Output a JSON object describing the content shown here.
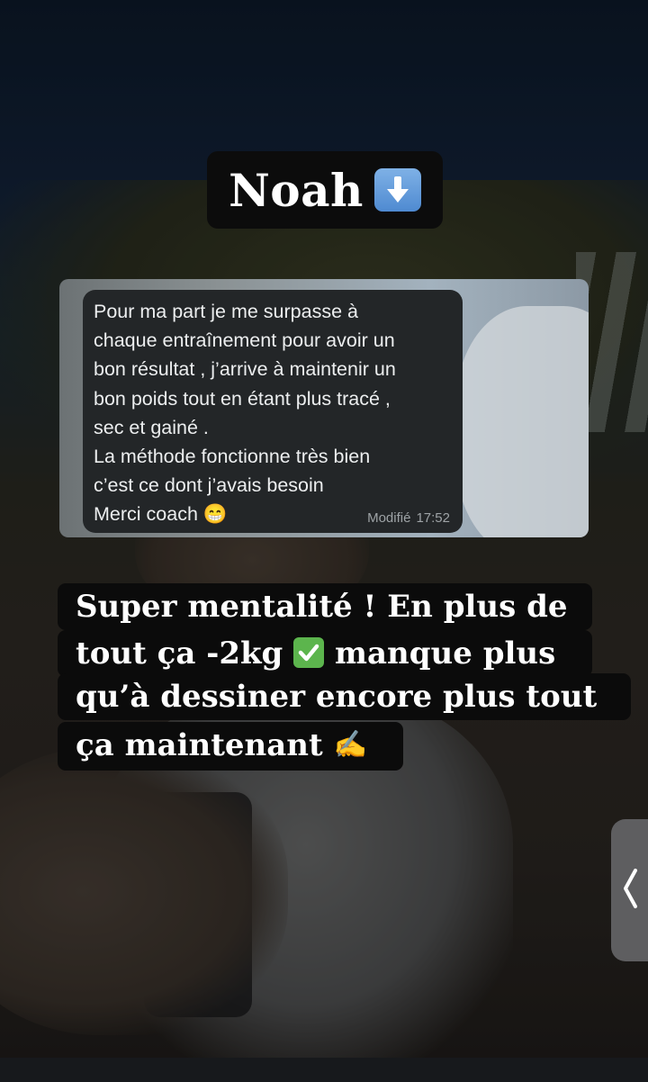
{
  "story": {
    "name_tag": {
      "name": "Noah",
      "icon": "down-arrow-icon"
    },
    "screenshot": {
      "message_lines": [
        "Pour ma part je me surpasse à",
        "chaque entraînement pour avoir un",
        "bon résultat , j’arrive à maintenir un",
        "bon poids tout en étant plus tracé ,",
        "sec et gainé .",
        "La méthode fonctionne très bien",
        "c’est ce dont j’avais besoin",
        "Merci coach 😁"
      ],
      "edited_label": "Modifié",
      "time": "17:52"
    },
    "caption": {
      "line1": "Super mentalité ! En plus de",
      "line2_before": "tout ça -2kg",
      "line2_after": "manque plus",
      "line3": "qu’à dessiner encore plus tout",
      "line4": "ça maintenant",
      "check_emoji": "✅",
      "hand_emoji": "✍"
    },
    "nav": {
      "previous_icon": "chevron-left-icon"
    }
  },
  "colors": {
    "tag_background": "#0c0c0c",
    "bubble_background": "#232628",
    "emoji_blue": "#5a93d6",
    "check_green": "#5cb54d"
  }
}
